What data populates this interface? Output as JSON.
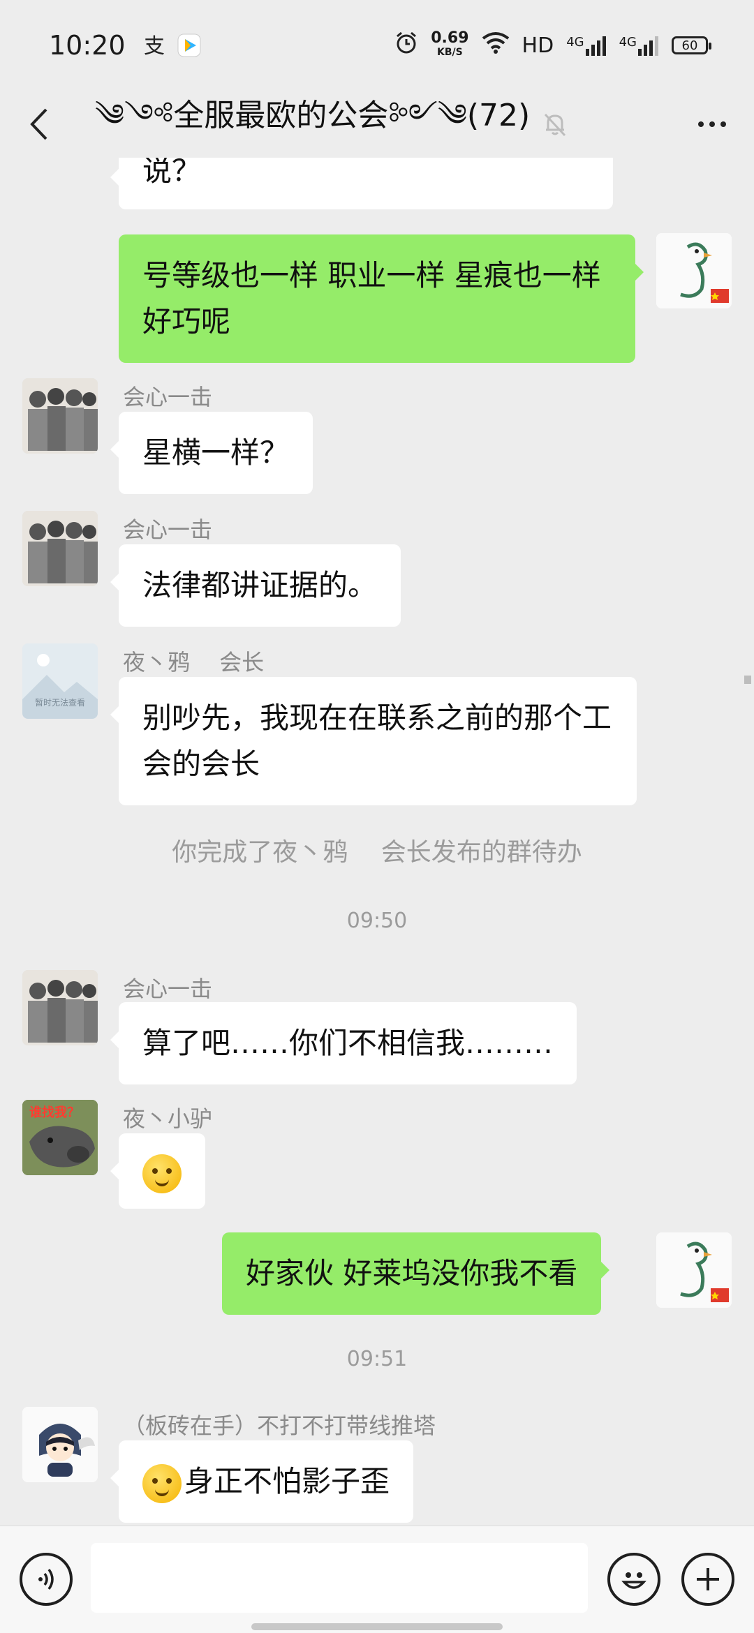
{
  "status_bar": {
    "time": "10:20",
    "net_speed_value": "0.69",
    "net_speed_unit": "KB/S",
    "network_label": "HD",
    "signal1_label": "4G",
    "signal2_label": "4G",
    "battery": "60"
  },
  "header": {
    "title": "༄༺全服最欧的公会༻༄(72)"
  },
  "messages": [
    {
      "text": "说？"
    },
    {
      "text": "号等级也一样 职业一样 星痕也一样 好巧呢"
    },
    {
      "sender": "会心一击",
      "text": "星横一样？"
    },
    {
      "sender": "会心一击",
      "text": "法律都讲证据的。"
    },
    {
      "sender": "夜丶鸦　 会长",
      "text": "别吵先，我现在在联系之前的那个工会的会长",
      "avatar_caption": "暂时无法查看"
    },
    {
      "system": "你完成了夜丶鸦　 会长发布的群待办"
    },
    {
      "timestamp": "09:50"
    },
    {
      "sender": "会心一击",
      "text": "算了吧……你们不相信我………"
    },
    {
      "sender": "夜丶小驴",
      "avatar_caption": "谁找我？"
    },
    {
      "text": "好家伙  好莱坞没你我不看"
    },
    {
      "timestamp": "09:51"
    },
    {
      "sender": "（板砖在手）不打不打带线推塔",
      "text": "身正不怕影子歪"
    }
  ],
  "colors": {
    "background": "#ededed",
    "my_bubble": "#95ec69",
    "other_bubble": "#ffffff",
    "meta_text": "#8a8a8a"
  },
  "icons": [
    "back-arrow-icon",
    "mute-bell-icon",
    "more-dots-icon",
    "voice-icon",
    "emoji-icon",
    "plus-icon"
  ]
}
